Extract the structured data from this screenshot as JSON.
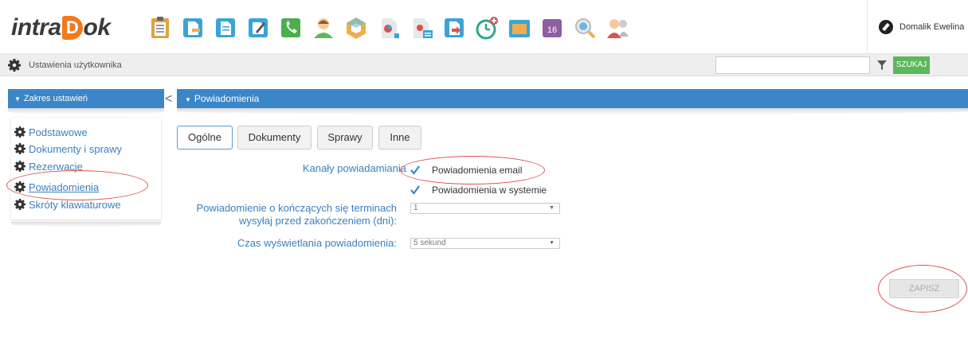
{
  "app": {
    "logo_text_left": "intra",
    "logo_text_d": "D",
    "logo_text_right": "ok",
    "user_name": "Domalik Ewelina"
  },
  "toolbar_icons": [
    {
      "name": "clipboard-icon",
      "color": "#d9a441"
    },
    {
      "name": "document-edit-icon",
      "color": "#3aa4d8"
    },
    {
      "name": "document-icon",
      "color": "#3aa4d8"
    },
    {
      "name": "pen-icon",
      "color": "#3aa4d8"
    },
    {
      "name": "phone-icon",
      "color": "#4cae4c"
    },
    {
      "name": "contact-icon",
      "color": "#5cb85c"
    },
    {
      "name": "cube-icon",
      "color": "#f0ad4e"
    },
    {
      "name": "document-chart-icon",
      "color": "#3aa4d8"
    },
    {
      "name": "document-stack-icon",
      "color": "#3aa4d8"
    },
    {
      "name": "document-arrow-icon",
      "color": "#3aa4d8"
    },
    {
      "name": "clock-add-icon",
      "color": "#2fa88a"
    },
    {
      "name": "folder-icon",
      "color": "#3aa4d8"
    },
    {
      "name": "calendar-icon",
      "color": "#8e5ea2"
    },
    {
      "name": "search-globe-icon",
      "color": "#3aa4d8"
    },
    {
      "name": "users-icon",
      "color": "#d9534f"
    }
  ],
  "calendar_day": "16",
  "subbar": {
    "title": "Ustawienia użytkownika",
    "search_placeholder": "",
    "search_button": "SZUKAJ"
  },
  "left_panel": {
    "header": "Zakres ustawień",
    "collapse": "<",
    "items": [
      {
        "label": "Podstawowe"
      },
      {
        "label": "Dokumenty i sprawy"
      },
      {
        "label": "Rezerwacje"
      },
      {
        "label": "Powiadomienia"
      },
      {
        "label": "Skróty klawiaturowe"
      }
    ]
  },
  "main": {
    "header": "Powiadomienia",
    "tabs": [
      {
        "label": "Ogólne"
      },
      {
        "label": "Dokumenty"
      },
      {
        "label": "Sprawy"
      },
      {
        "label": "Inne"
      }
    ],
    "channels_label": "Kanały powiadamiania",
    "channels": [
      {
        "label": "Powiadomienia email",
        "checked": true
      },
      {
        "label": "Powiadomienia w systemie",
        "checked": true
      }
    ],
    "deadline_label_line1": "Powiadomienie o kończących się terminach",
    "deadline_label_line2": "wysyłaj przed zakończeniem (dni):",
    "deadline_value": "1",
    "display_time_label": "Czas wyświetlania powiadomienia:",
    "display_time_value": "5 sekund",
    "save_button": "ZAPISZ"
  },
  "colors": {
    "accent_blue": "#3a86c8",
    "link_blue": "#3a7fc1",
    "search_green": "#5cb85c",
    "annotation_red": "#d9534f"
  }
}
